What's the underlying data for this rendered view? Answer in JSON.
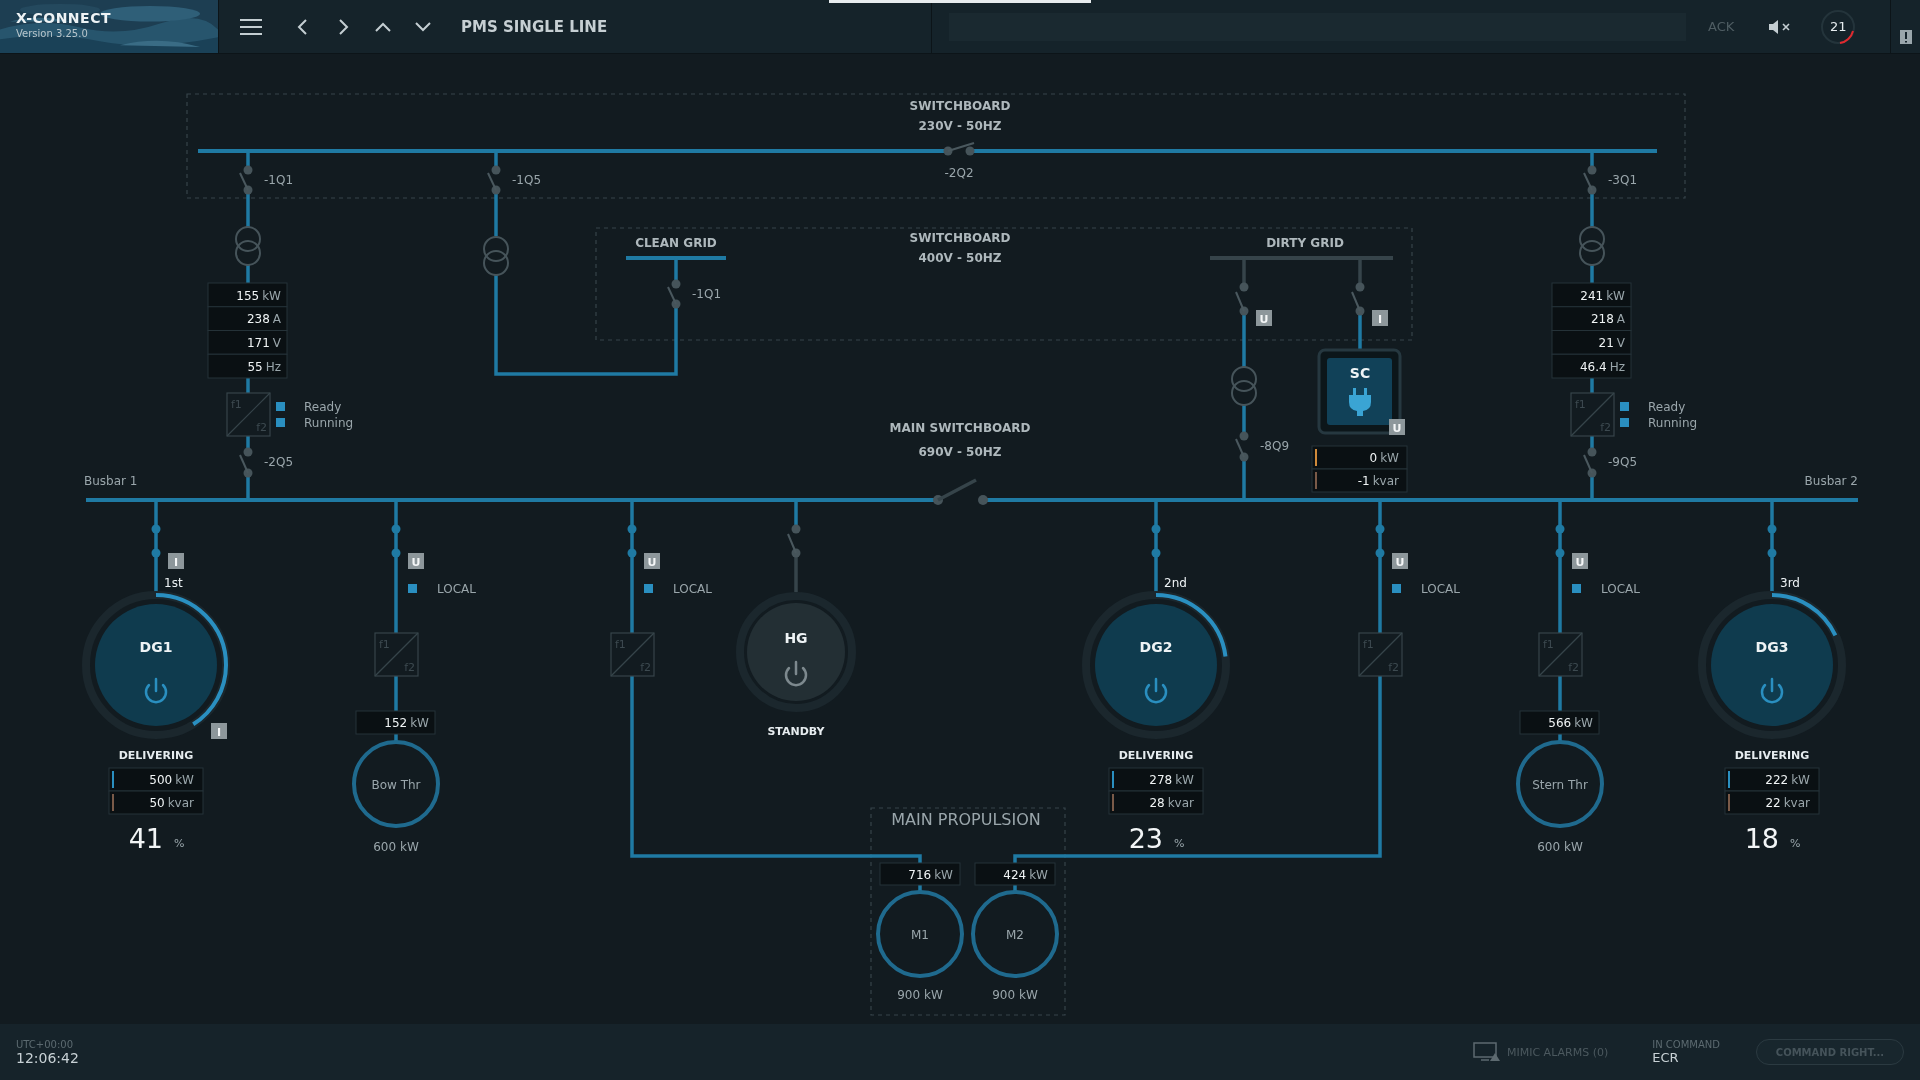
{
  "header": {
    "app_name": "X-CONNECT",
    "version": "Version 3.25.0",
    "page_title": "PMS SINGLE LINE",
    "ack": "ACK",
    "alarm_count": "21"
  },
  "switchboards": [
    {
      "title": "SWITCHBOARD",
      "rating": "230V - 50HZ"
    },
    {
      "title": "SWITCHBOARD",
      "rating": "400V - 50HZ"
    },
    {
      "title": "MAIN SWITCHBOARD",
      "rating": "690V - 50HZ"
    }
  ],
  "breakers": [
    {
      "label": "-1Q1",
      "closed": false
    },
    {
      "label": "-1Q5",
      "closed": false
    },
    {
      "label": "-2Q2",
      "closed": false
    },
    {
      "label": "-3Q1",
      "closed": false
    },
    {
      "label": "-1Q1",
      "closed": false
    },
    {
      "label": "-8Q9",
      "closed": false
    },
    {
      "label": "-2Q5",
      "closed": false
    },
    {
      "label": "-9Q5",
      "closed": false
    }
  ],
  "clean_grid": {
    "label": "CLEAN GRID"
  },
  "dirty_grid": {
    "label": "DIRTY GRID",
    "breakers": [
      {
        "badge": "U",
        "closed": false
      },
      {
        "badge": "I",
        "closed": false
      }
    ]
  },
  "transformer_feeders": [
    {
      "readings": [
        {
          "value": "155",
          "unit": "kW"
        },
        {
          "value": "238",
          "unit": "A"
        },
        {
          "value": "171",
          "unit": "V"
        },
        {
          "value": "55",
          "unit": "Hz"
        }
      ],
      "converter": {
        "in": "f1",
        "out": "f2"
      },
      "statuses": [
        {
          "label": "Ready",
          "on": true
        },
        {
          "label": "Running",
          "on": true
        }
      ]
    },
    {
      "readings": [
        {
          "value": "241",
          "unit": "kW"
        },
        {
          "value": "218",
          "unit": "A"
        },
        {
          "value": "21",
          "unit": "V"
        },
        {
          "value": "46.4",
          "unit": "Hz"
        }
      ],
      "converter": {
        "in": "f1",
        "out": "f2"
      },
      "statuses": [
        {
          "label": "Ready",
          "on": true
        },
        {
          "label": "Running",
          "on": true
        }
      ]
    }
  ],
  "shore_connection": {
    "name": "SC",
    "badge": "U",
    "readings": [
      {
        "value": "0",
        "unit": "kW",
        "color": "#d08a3a"
      },
      {
        "value": "-1",
        "unit": "kvar",
        "color": "#7a5a48"
      }
    ]
  },
  "main_bus": {
    "left_label": "Busbar 1",
    "right_label": "Busbar 2",
    "tie_closed": false
  },
  "outgoing": [
    {
      "kind": "generator",
      "name": "DG1",
      "closed": true,
      "breaker_badge": "I",
      "order": "1st",
      "ring_badge": "I",
      "running": true,
      "level": 0.41,
      "status": "DELIVERING",
      "readings": [
        {
          "value": "500",
          "unit": "kW",
          "color": "#2a8fc0"
        },
        {
          "value": "50",
          "unit": "kvar",
          "color": "#7a5a48"
        }
      ],
      "load": "41",
      "load_unit": "%"
    },
    {
      "kind": "thruster",
      "name": "Bow Thr",
      "closed": true,
      "breaker_badge": "U",
      "mode": {
        "label": "LOCAL",
        "on": true
      },
      "converter": {
        "in": "f1",
        "out": "f2"
      },
      "power": {
        "value": "152",
        "unit": "kW"
      },
      "rating": "600 kW"
    },
    {
      "kind": "propulsion_feeder",
      "closed": true,
      "breaker_badge": "U",
      "mode": {
        "label": "LOCAL",
        "on": true
      },
      "converter": {
        "in": "f1",
        "out": "f2"
      }
    },
    {
      "kind": "harbour_generator",
      "name": "HG",
      "closed": false,
      "running": false,
      "status": "STANDBY"
    },
    {
      "kind": "generator",
      "name": "DG2",
      "closed": true,
      "order": "2nd",
      "running": true,
      "level": 0.23,
      "status": "DELIVERING",
      "readings": [
        {
          "value": "278",
          "unit": "kW",
          "color": "#2a8fc0"
        },
        {
          "value": "28",
          "unit": "kvar",
          "color": "#7a5a48"
        }
      ],
      "load": "23",
      "load_unit": "%"
    },
    {
      "kind": "propulsion_feeder",
      "closed": true,
      "breaker_badge": "U",
      "mode": {
        "label": "LOCAL",
        "on": true
      },
      "converter": {
        "in": "f1",
        "out": "f2"
      }
    },
    {
      "kind": "thruster",
      "name": "Stern Thr",
      "closed": true,
      "breaker_badge": "U",
      "mode": {
        "label": "LOCAL",
        "on": true
      },
      "converter": {
        "in": "f1",
        "out": "f2"
      },
      "power": {
        "value": "566",
        "unit": "kW"
      },
      "rating": "600 kW"
    },
    {
      "kind": "generator",
      "name": "DG3",
      "closed": true,
      "order": "3rd",
      "running": true,
      "level": 0.18,
      "status": "DELIVERING",
      "readings": [
        {
          "value": "222",
          "unit": "kW",
          "color": "#2a8fc0"
        },
        {
          "value": "22",
          "unit": "kvar",
          "color": "#7a5a48"
        }
      ],
      "load": "18",
      "load_unit": "%"
    }
  ],
  "propulsion": {
    "title": "MAIN PROPULSION",
    "motors": [
      {
        "name": "M1",
        "power": {
          "value": "716",
          "unit": "kW"
        },
        "rating": "900 kW"
      },
      {
        "name": "M2",
        "power": {
          "value": "424",
          "unit": "kW"
        },
        "rating": "900 kW"
      }
    ]
  },
  "footer": {
    "timezone": "UTC+00:00",
    "time": "12:06:42",
    "alarms": "MIMIC ALARMS (0)",
    "command_label": "IN COMMAND",
    "command_station": "ECR",
    "command_button": {
      "label": "COMMAND RIGHT...",
      "disabled": true
    }
  }
}
